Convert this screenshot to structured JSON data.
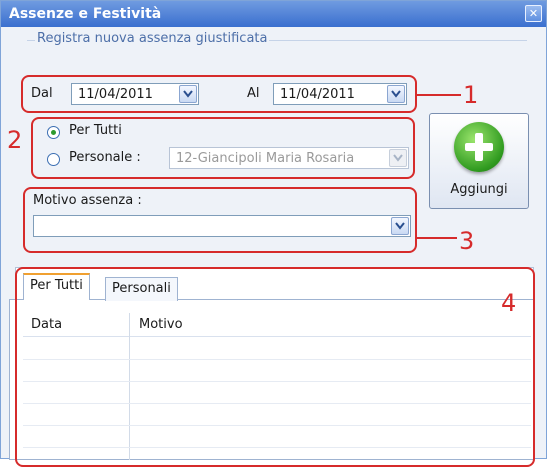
{
  "window": {
    "title": "Assenze e Festività",
    "close_icon": "✕"
  },
  "group": {
    "legend": "Registra nuova assenza giustificata"
  },
  "dates": {
    "from_label": "Dal",
    "from_value": "11/04/2011",
    "to_label": "Al",
    "to_value": "11/04/2011"
  },
  "target": {
    "options": [
      {
        "label": "Per Tutti",
        "checked": true
      },
      {
        "label": "Personale :",
        "checked": false
      }
    ],
    "person_value": "12-Giancipoli Maria Rosaria"
  },
  "reason": {
    "label": "Motivo assenza :",
    "value": ""
  },
  "add_button": {
    "label": "Aggiungi",
    "icon": "plus-circle-icon"
  },
  "tabs": [
    {
      "label": "Per Tutti",
      "active": true
    },
    {
      "label": "Personali",
      "active": false
    }
  ],
  "grid": {
    "columns": [
      "Data",
      "Motivo"
    ],
    "rows": []
  },
  "annotations": [
    "1",
    "2",
    "3",
    "4"
  ],
  "colors": {
    "annotation": "#d62b2b",
    "titlebar": "#3a6fcf",
    "radio_checked": "#2d9a2d"
  }
}
